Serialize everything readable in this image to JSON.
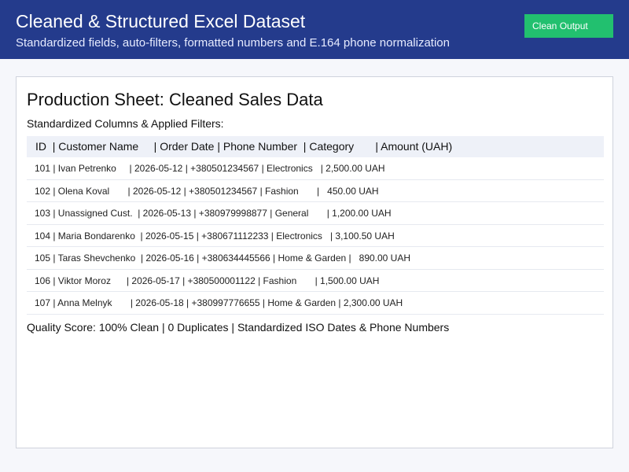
{
  "header": {
    "title": "Cleaned & Structured Excel Dataset",
    "subtitle": "Standardized fields, auto-filters, formatted numbers and E.164 phone normalization",
    "status_button": "Clean Output"
  },
  "sheet": {
    "title": "Production Sheet: Cleaned Sales Data",
    "columns_caption": "Standardized Columns & Applied Filters:",
    "header_row": "ID  | Customer Name     | Order Date | Phone Number  | Category       | Amount (UAH)",
    "rows": [
      "101 | Ivan Petrenko     | 2026-05-12 | +380501234567 | Electronics   | 2,500.00 UAH",
      "102 | Olena Koval       | 2026-05-12 | +380501234567 | Fashion       |   450.00 UAH",
      "103 | Unassigned Cust.  | 2026-05-13 | +380979998877 | General       | 1,200.00 UAH",
      "104 | Maria Bondarenko  | 2026-05-15 | +380671112233 | Electronics   | 3,100.50 UAH",
      "105 | Taras Shevchenko  | 2026-05-16 | +380634445566 | Home & Garden |   890.00 UAH",
      "106 | Viktor Moroz      | 2026-05-17 | +380500001122 | Fashion       | 1,500.00 UAH",
      "107 | Anna Melnyk       | 2026-05-18 | +380997776655 | Home & Garden | 2,300.00 UAH"
    ],
    "quality_summary": "Quality Score: 100% Clean | 0 Duplicates | Standardized ISO Dates & Phone Numbers"
  },
  "colors": {
    "header_bg": "#243b8c",
    "status_green": "#22c06f",
    "table_header_bg": "#eef1f8"
  }
}
